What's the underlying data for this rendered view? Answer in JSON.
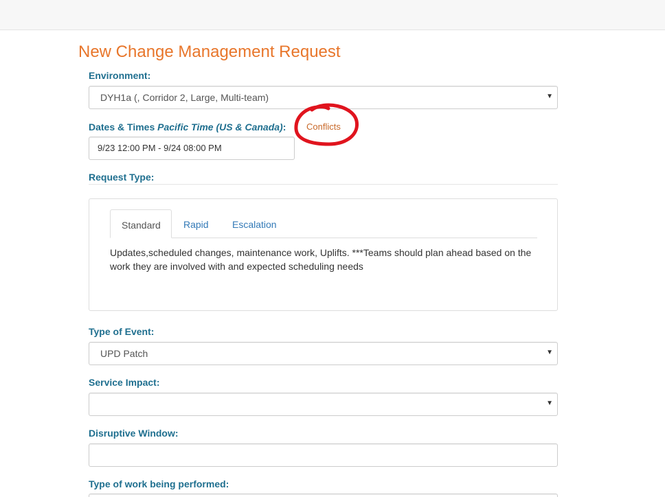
{
  "page": {
    "title": "New Change Management Request"
  },
  "environment": {
    "label": "Environment:",
    "selected": "DYH1a (, Corridor 2, Large, Multi-team)"
  },
  "dates": {
    "label": "Dates & Times ",
    "timezone": "Pacific Time (US & Canada)",
    "colon": ":",
    "conflicts_link": "Conflicts",
    "value": "9/23 12:00 PM - 9/24 08:00 PM"
  },
  "request_type": {
    "label": "Request Type:",
    "tabs": [
      {
        "label": "Standard",
        "active": true
      },
      {
        "label": "Rapid",
        "active": false
      },
      {
        "label": "Escalation",
        "active": false
      }
    ],
    "description": "Updates,scheduled changes, maintenance work, Uplifts. ***Teams should plan ahead based on the work they are involved with and expected scheduling needs"
  },
  "type_of_event": {
    "label": "Type of Event:",
    "selected": "UPD Patch"
  },
  "service_impact": {
    "label": "Service Impact:",
    "selected": ""
  },
  "disruptive_window": {
    "label": "Disruptive Window:",
    "value": ""
  },
  "type_of_work": {
    "label": "Type of work being performed:"
  },
  "icons": {
    "dropdown_caret": "triangle-down",
    "annotation": "red-hand-drawn-circle"
  },
  "colors": {
    "title": "#e8762b",
    "label": "#1f6f8f",
    "link": "#337ab7",
    "conflicts": "#c8692a",
    "annotation": "#e0141e"
  }
}
